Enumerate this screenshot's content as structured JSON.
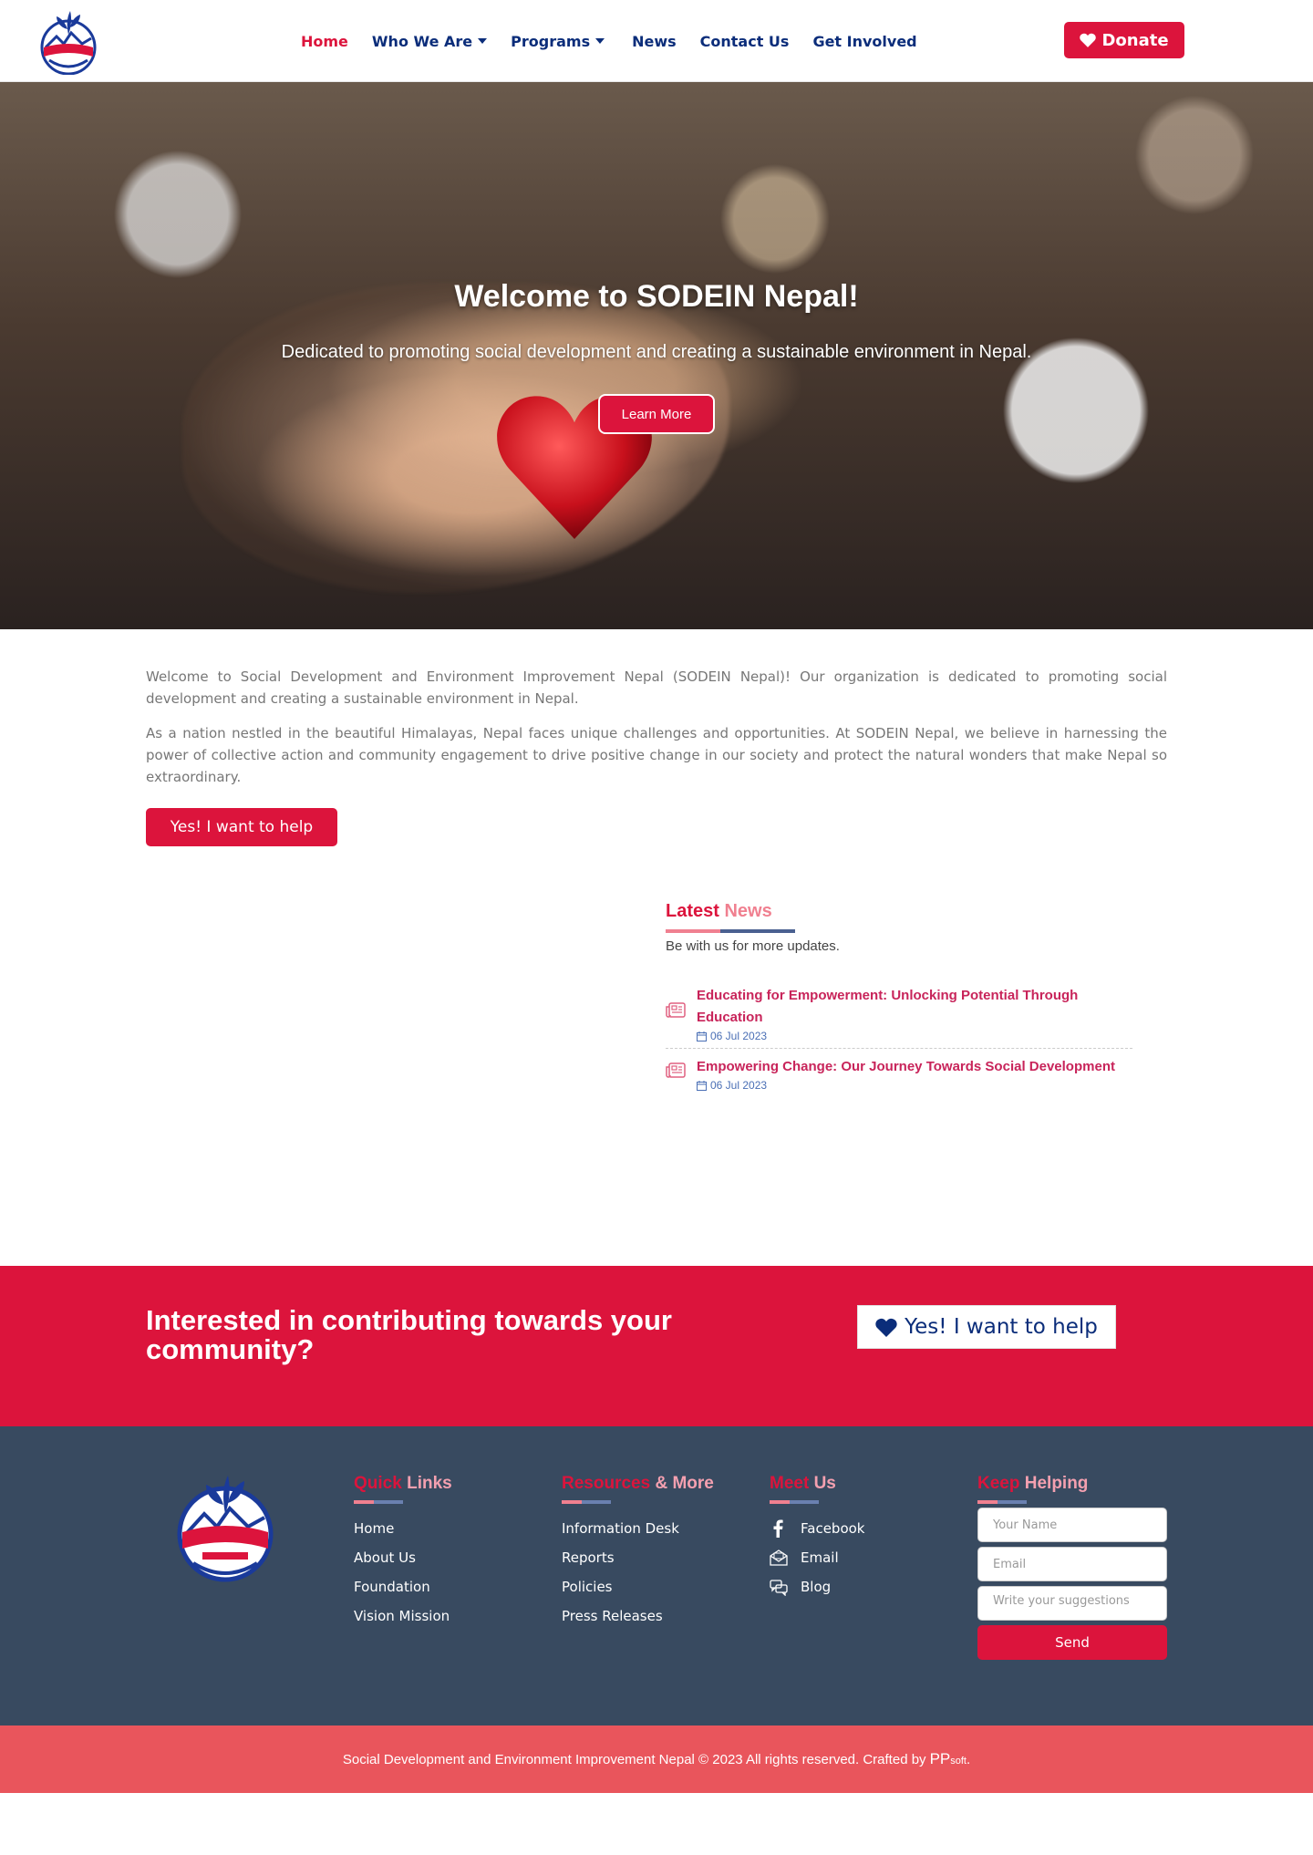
{
  "header": {
    "nav": [
      {
        "label": "Home",
        "active": true,
        "dropdown": false
      },
      {
        "label": "Who We Are",
        "active": false,
        "dropdown": true
      },
      {
        "label": "Programs",
        "active": false,
        "dropdown": true
      },
      {
        "label": "News",
        "active": false,
        "dropdown": false
      },
      {
        "label": "Contact Us",
        "active": false,
        "dropdown": false
      },
      {
        "label": "Get Involved",
        "active": false,
        "dropdown": false
      }
    ],
    "donate_label": "Donate"
  },
  "hero": {
    "title": "Welcome to SODEIN Nepal!",
    "subtitle": "Dedicated to promoting social development and creating a sustainable environment in Nepal.",
    "button_label": "Learn More"
  },
  "intro": {
    "paragraphs": [
      "Welcome to Social Development and Environment Improvement Nepal (SODEIN Nepal)! Our organization is dedicated to promoting social development and creating a sustainable environment in Nepal.",
      "As a nation nestled in the beautiful Himalayas, Nepal faces unique challenges and opportunities. At SODEIN Nepal, we believe in harnessing the power of collective action and community engagement to drive positive change in our society and protect the natural wonders that make Nepal so extraordinary."
    ],
    "button_label": "Yes! I want to help"
  },
  "news": {
    "title_part1": "Latest",
    "title_part2": "News",
    "subtitle": "Be with us for more updates.",
    "items": [
      {
        "headline": "Educating for Empowerment: Unlocking Potential Through Education",
        "date": "06 Jul 2023"
      },
      {
        "headline": "Empowering Change: Our Journey Towards Social Development",
        "date": "06 Jul 2023"
      }
    ]
  },
  "cta": {
    "text": "Interested in contributing towards your community?",
    "button_label": "Yes! I want to help"
  },
  "footer": {
    "quick_links": {
      "title_hl": "Quick",
      "title_rest": "Links",
      "items": [
        "Home",
        "About Us",
        "Foundation",
        "Vision Mission"
      ]
    },
    "resources": {
      "title_hl": "Resources",
      "title_rest": "& More",
      "items": [
        "Information Desk",
        "Reports",
        "Policies",
        "Press Releases"
      ]
    },
    "meet_us": {
      "title_hl": "Meet",
      "title_rest": "Us",
      "items": [
        {
          "label": "Facebook",
          "icon": "facebook-icon"
        },
        {
          "label": "Email",
          "icon": "email-icon"
        },
        {
          "label": "Blog",
          "icon": "blog-icon"
        }
      ]
    },
    "keep_helping": {
      "title_hl": "Keep",
      "title_rest": "Helping",
      "name_placeholder": "Your Name",
      "email_placeholder": "Email",
      "message_placeholder": "Write your suggestions",
      "send_label": "Send"
    }
  },
  "copyright": {
    "text": "Social Development and Environment Improvement Nepal © 2023 All rights reserved. Crafted by",
    "brand_main": "PP",
    "brand_suffix": "soft",
    "end": "."
  },
  "colors": {
    "primary": "#dc143c",
    "navy": "#0b2d7a",
    "footer_bg": "#384a60",
    "copyright_bg": "#e9555c"
  }
}
